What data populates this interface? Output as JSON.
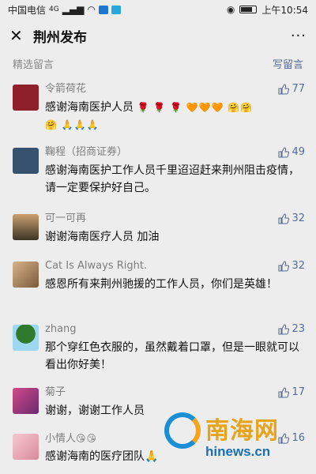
{
  "status_bar": {
    "carrier": "中国电信",
    "signal": "4G",
    "time": "上午10:54"
  },
  "nav": {
    "close_icon": "✕",
    "title": "荆州发布",
    "more_icon": "···"
  },
  "section": {
    "title": "精选留言",
    "write_label": "写留言"
  },
  "comments": [
    {
      "name": "令箭荷花",
      "likes": "77",
      "text": "感谢海南医护人员",
      "emoji": "🌹 🌹 🌹 🧡🧡🧡 🤗🤗",
      "emoji2": "🤗 🙏🙏🙏",
      "avatar_color": "#8e1f2b"
    },
    {
      "name": "鞠程（招商证券）",
      "likes": "49",
      "text": "感谢海南医护工作人员千里迢迢赶来荆州阻击疫情，请一定要保护好自己。",
      "avatar_color": "#37526e"
    },
    {
      "name": "可一可再",
      "likes": "32",
      "text": "谢谢海南医疗人员 加油",
      "avatar_color": "#8a6a3a"
    },
    {
      "name": "Cat Is Always Right.",
      "likes": "32",
      "text": "感恩所有来荆州驰援的工作人员，你们是英雄！",
      "avatar_color": "#b07b4f"
    },
    {
      "name": "zhang",
      "likes": "23",
      "text": "那个穿红色衣服的，虽然戴着口罩，但是一眼就可以看出你好美！",
      "avatar_color": "#3f8e3a"
    },
    {
      "name": "菊子",
      "likes": "17",
      "text": "谢谢，谢谢工作人员",
      "avatar_color": "#b43a6a"
    },
    {
      "name": "小情人",
      "name_emoji": "😘😘",
      "likes": "16",
      "text": "感谢海南的医疗团队🙏",
      "avatar_color": "#e9a9b6"
    }
  ],
  "watermark": {
    "title": "南海网",
    "url": "hinews.cn"
  },
  "colors": {
    "link": "#576b95",
    "background": "#ededed"
  }
}
